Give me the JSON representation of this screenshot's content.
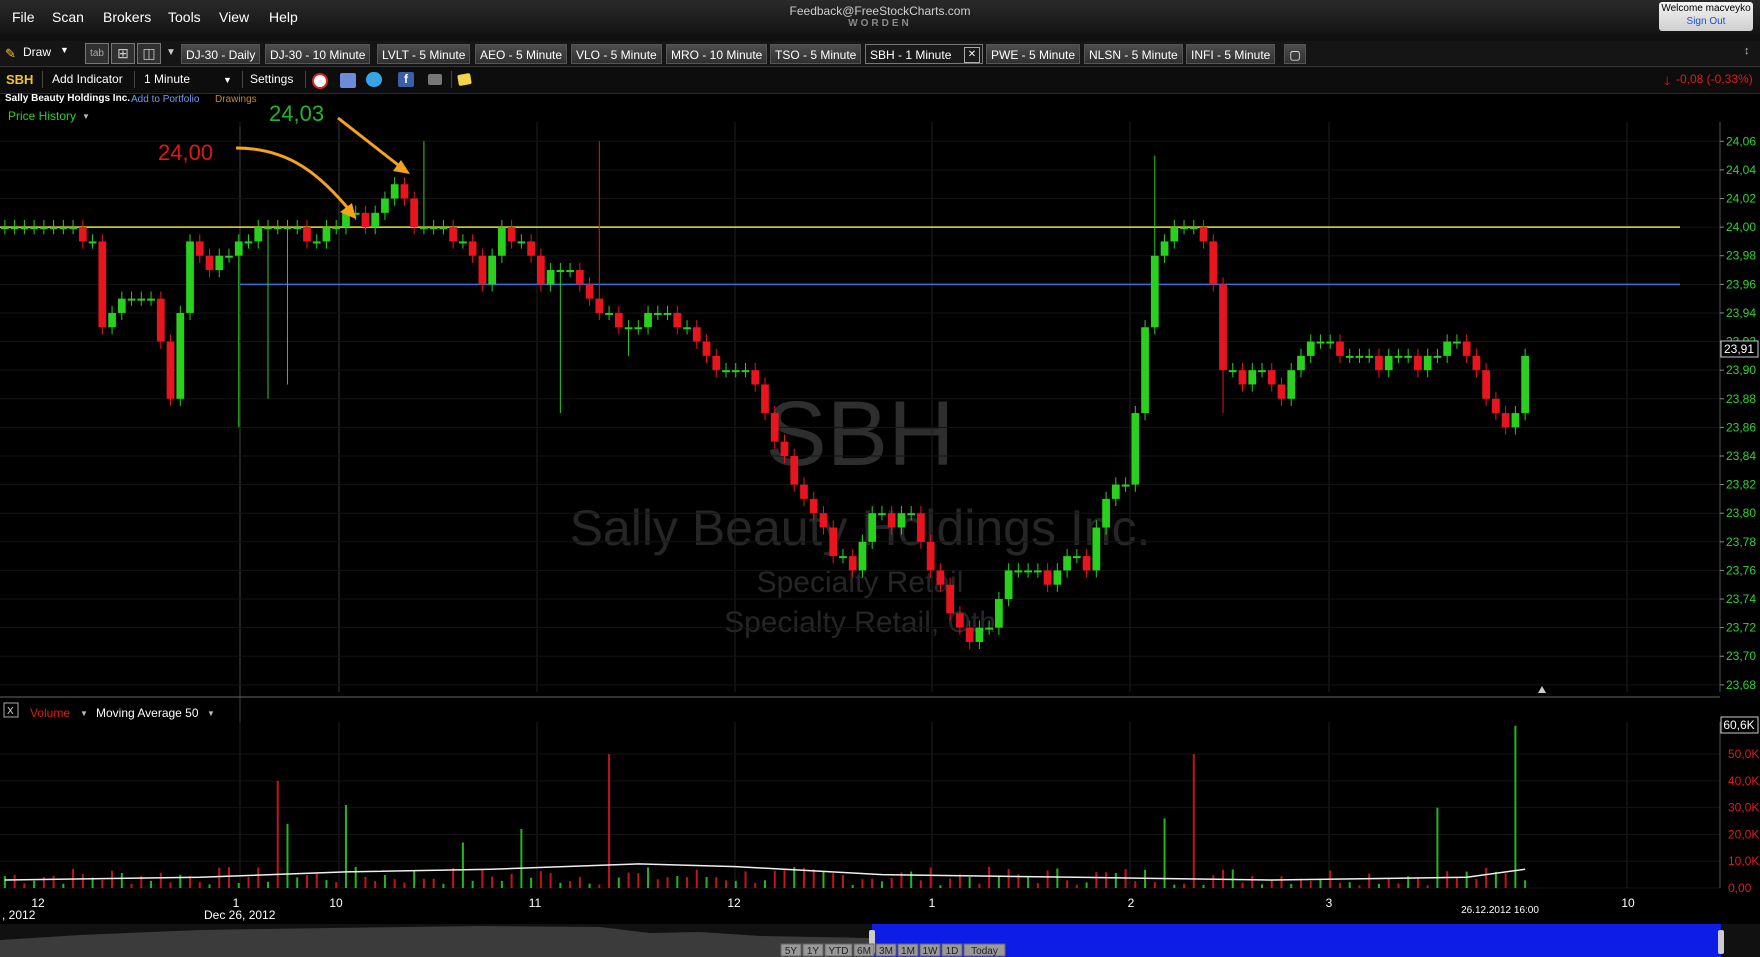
{
  "menu": [
    "File",
    "Scan",
    "Brokers",
    "Tools",
    "View",
    "Help"
  ],
  "header": {
    "feedback": "Feedback@FreeStockCharts.com",
    "brand": "WORDEN",
    "welcome": "Welcome macveyko",
    "sign_out": "Sign Out"
  },
  "drawbar": {
    "draw_label": "Draw",
    "tab_label": "tab"
  },
  "tabs": [
    "DJ-30 - Daily",
    "DJ-30 - 10 Minute",
    "LVLT - 5 Minute",
    "AEO - 5 Minute",
    "VLO - 5 Minute",
    "MRO - 10 Minute",
    "TSO - 5 Minute",
    "SBH - 1 Minute",
    "PWE - 5 Minute",
    "NLSN - 5 Minute",
    "INFI - 5 Minute"
  ],
  "active_tab": "SBH - 1 Minute",
  "toolbar": {
    "symbol": "SBH",
    "add_indicator": "Add Indicator",
    "interval": "1 Minute",
    "settings": "Settings",
    "change": "-0,08 (-0,33%)"
  },
  "info": {
    "company": "Sally Beauty Holdings Inc.",
    "add_to_portfolio": "Add to Portfolio",
    "drawings": "Drawings",
    "price_history": "Price History"
  },
  "watermark": {
    "symbol": "SBH",
    "name": "Sally Beauty Holdings Inc.",
    "sector": "Specialty Retail",
    "industry": "Specialty Retail, Oth"
  },
  "annotations": {
    "left_label": "24,00",
    "right_label": "24,03"
  },
  "volume_panel": {
    "volume_label": "Volume",
    "ma_label": "Moving Average 50",
    "current": "60,6K"
  },
  "timeline": {
    "buttons": [
      "5Y",
      "1Y",
      "YTD",
      "6M",
      "3M",
      "1M",
      "1W",
      "1D",
      "Today"
    ]
  },
  "colors": {
    "up": "#29d01d",
    "down": "#e8151f",
    "axis": "#2bd62b",
    "resistance": "#e8e52e",
    "support": "#2f76d8",
    "arrow": "#f6a21c",
    "label_red": "#e01818",
    "label_green": "#22b52a",
    "volume_down": "#c4131a",
    "volume_up": "#1fb81f"
  },
  "chart_data": {
    "type": "candlestick",
    "price_axis": {
      "ticks": [
        "24,06",
        "24,04",
        "24,02",
        "24,00",
        "23,98",
        "23,96",
        "23,94",
        "23,92",
        "23,90",
        "23,88",
        "23,86",
        "23,84",
        "23,82",
        "23,80",
        "23,78",
        "23,76",
        "23,74",
        "23,72",
        "23,70",
        "23,68"
      ],
      "last_price": "23,91",
      "ylim": [
        23.675,
        24.07
      ]
    },
    "horizontal_lines": [
      {
        "value": 24.0,
        "color": "#e8e52e"
      },
      {
        "value": 23.96,
        "color": "#2f76d8"
      }
    ],
    "time_axis": {
      "ticks": [
        "12",
        "1",
        "10",
        "11",
        "12",
        "1",
        "2",
        "3",
        "10"
      ],
      "date_labels": [
        ", 2012",
        "Dec 26, 2012"
      ],
      "cursor_time": "26.12.2012 16:00"
    },
    "close_path": [
      [
        0,
        24.0
      ],
      [
        7,
        24.0
      ],
      [
        9,
        23.99
      ],
      [
        10,
        23.93
      ],
      [
        12,
        23.95
      ],
      [
        15,
        23.95
      ],
      [
        17,
        23.88
      ],
      [
        19,
        23.99
      ],
      [
        21,
        23.97
      ],
      [
        24,
        23.99
      ],
      [
        27,
        24.0
      ],
      [
        30,
        24.0
      ],
      [
        32,
        23.99
      ],
      [
        35,
        24.01
      ],
      [
        37,
        24.0
      ],
      [
        39,
        24.02
      ],
      [
        40,
        24.03
      ],
      [
        42,
        24.0
      ],
      [
        45,
        24.0
      ],
      [
        47,
        23.99
      ],
      [
        49,
        23.96
      ],
      [
        51,
        24.0
      ],
      [
        53,
        23.99
      ],
      [
        55,
        23.96
      ],
      [
        57,
        23.97
      ],
      [
        59,
        23.96
      ],
      [
        61,
        23.94
      ],
      [
        63,
        23.93
      ],
      [
        65,
        23.93
      ],
      [
        67,
        23.94
      ],
      [
        69,
        23.93
      ],
      [
        71,
        23.92
      ],
      [
        73,
        23.9
      ],
      [
        75,
        23.9
      ],
      [
        77,
        23.89
      ],
      [
        79,
        23.85
      ],
      [
        81,
        23.82
      ],
      [
        83,
        23.8
      ],
      [
        85,
        23.77
      ],
      [
        87,
        23.76
      ],
      [
        89,
        23.8
      ],
      [
        91,
        23.79
      ],
      [
        93,
        23.8
      ],
      [
        95,
        23.76
      ],
      [
        97,
        23.73
      ],
      [
        98,
        23.72
      ],
      [
        99,
        23.71
      ],
      [
        101,
        23.72
      ],
      [
        103,
        23.76
      ],
      [
        105,
        23.76
      ],
      [
        107,
        23.75
      ],
      [
        109,
        23.77
      ],
      [
        111,
        23.76
      ],
      [
        113,
        23.81
      ],
      [
        115,
        23.82
      ],
      [
        116,
        23.87
      ],
      [
        118,
        23.98
      ],
      [
        120,
        24.0
      ],
      [
        122,
        24.0
      ],
      [
        123,
        23.99
      ],
      [
        124,
        23.96
      ],
      [
        125,
        23.9
      ],
      [
        127,
        23.89
      ],
      [
        129,
        23.9
      ],
      [
        131,
        23.88
      ],
      [
        133,
        23.91
      ],
      [
        135,
        23.92
      ],
      [
        137,
        23.91
      ],
      [
        139,
        23.91
      ],
      [
        141,
        23.9
      ],
      [
        143,
        23.91
      ],
      [
        145,
        23.9
      ],
      [
        147,
        23.91
      ],
      [
        149,
        23.92
      ],
      [
        151,
        23.9
      ],
      [
        152,
        23.88
      ],
      [
        153,
        23.87
      ],
      [
        154,
        23.86
      ],
      [
        155,
        23.87
      ],
      [
        156,
        23.91
      ]
    ],
    "spikes": [
      [
        24,
        23.86
      ],
      [
        27,
        23.88
      ],
      [
        29,
        23.89
      ],
      [
        43,
        24.06
      ],
      [
        57,
        23.87
      ],
      [
        61,
        24.06
      ],
      [
        64,
        23.91
      ],
      [
        118,
        24.05
      ],
      [
        125,
        23.87
      ]
    ],
    "volume_axis": {
      "ticks": [
        "50,0K",
        "40,0K",
        "30,0K",
        "20,0K",
        "10,0K",
        "0,00"
      ],
      "ylim": [
        0,
        62000
      ]
    },
    "volume_spikes_k": [
      [
        28,
        40
      ],
      [
        29,
        24
      ],
      [
        35,
        31
      ],
      [
        47,
        17
      ],
      [
        53,
        22
      ],
      [
        62,
        50
      ],
      [
        119,
        26
      ],
      [
        122,
        50
      ],
      [
        147,
        30
      ],
      [
        155,
        60.6
      ]
    ],
    "volume_ma_k": [
      [
        0,
        3
      ],
      [
        20,
        4
      ],
      [
        35,
        6
      ],
      [
        50,
        7
      ],
      [
        65,
        9
      ],
      [
        75,
        8
      ],
      [
        90,
        5
      ],
      [
        110,
        4
      ],
      [
        130,
        3
      ],
      [
        150,
        4
      ],
      [
        156,
        7
      ]
    ]
  }
}
